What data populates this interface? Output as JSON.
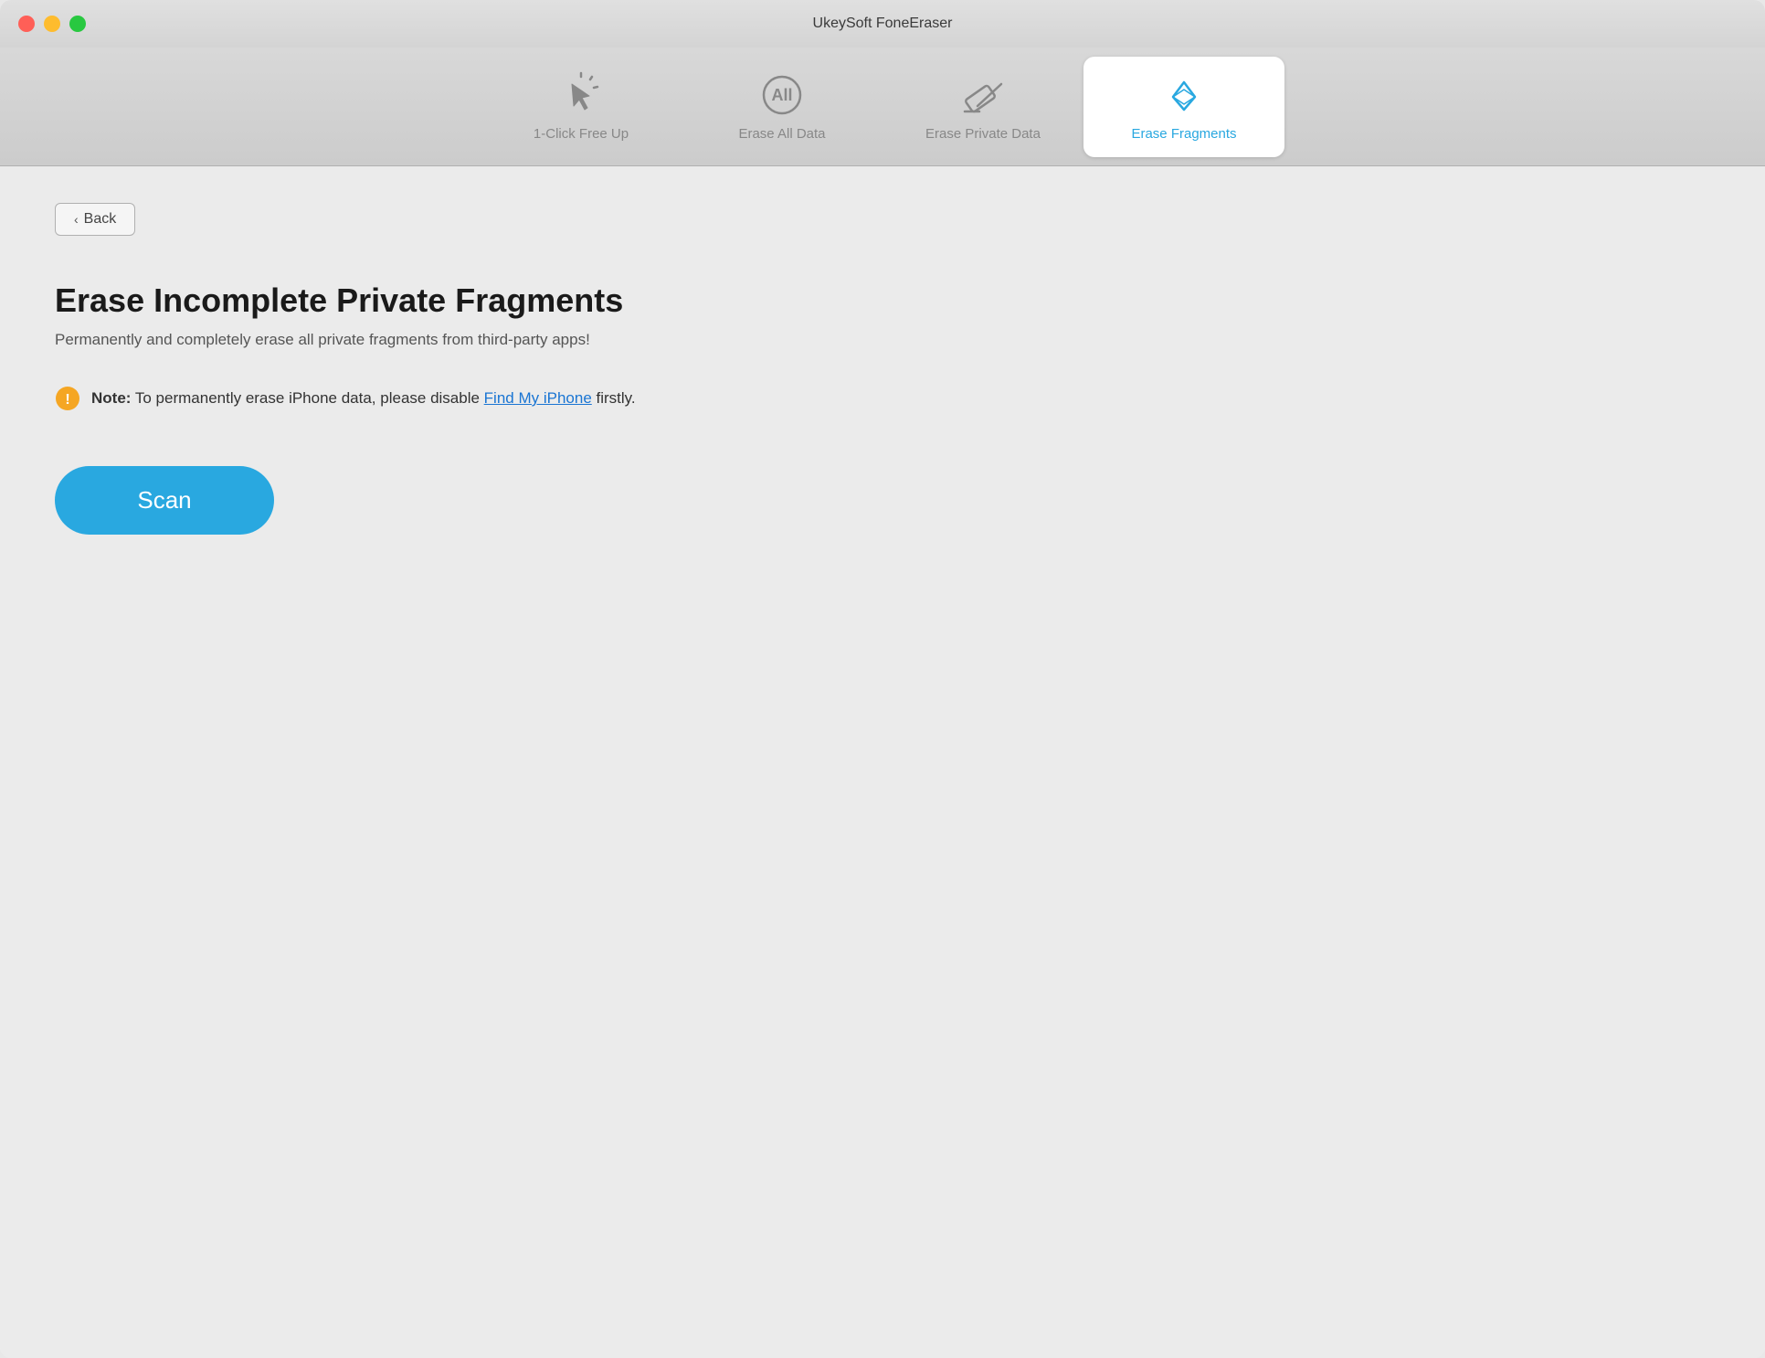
{
  "titleBar": {
    "title": "UkeySoft FoneEraser"
  },
  "tabs": [
    {
      "id": "one-click",
      "label": "1-Click Free Up",
      "active": false,
      "iconType": "cursor"
    },
    {
      "id": "erase-all",
      "label": "Erase All Data",
      "active": false,
      "iconType": "all"
    },
    {
      "id": "erase-private",
      "label": "Erase Private Data",
      "active": false,
      "iconType": "eraser"
    },
    {
      "id": "erase-fragments",
      "label": "Erase Fragments",
      "active": true,
      "iconType": "diamond-eraser"
    }
  ],
  "backButton": {
    "label": "Back"
  },
  "content": {
    "title": "Erase Incomplete Private Fragments",
    "subtitle": "Permanently and completely erase all private fragments from third-party apps!",
    "notePrefix": "Note:",
    "noteText": " To permanently erase iPhone data, please disable ",
    "noteLink": "Find My iPhone",
    "noteSuffix": " firstly."
  },
  "scanButton": {
    "label": "Scan"
  }
}
